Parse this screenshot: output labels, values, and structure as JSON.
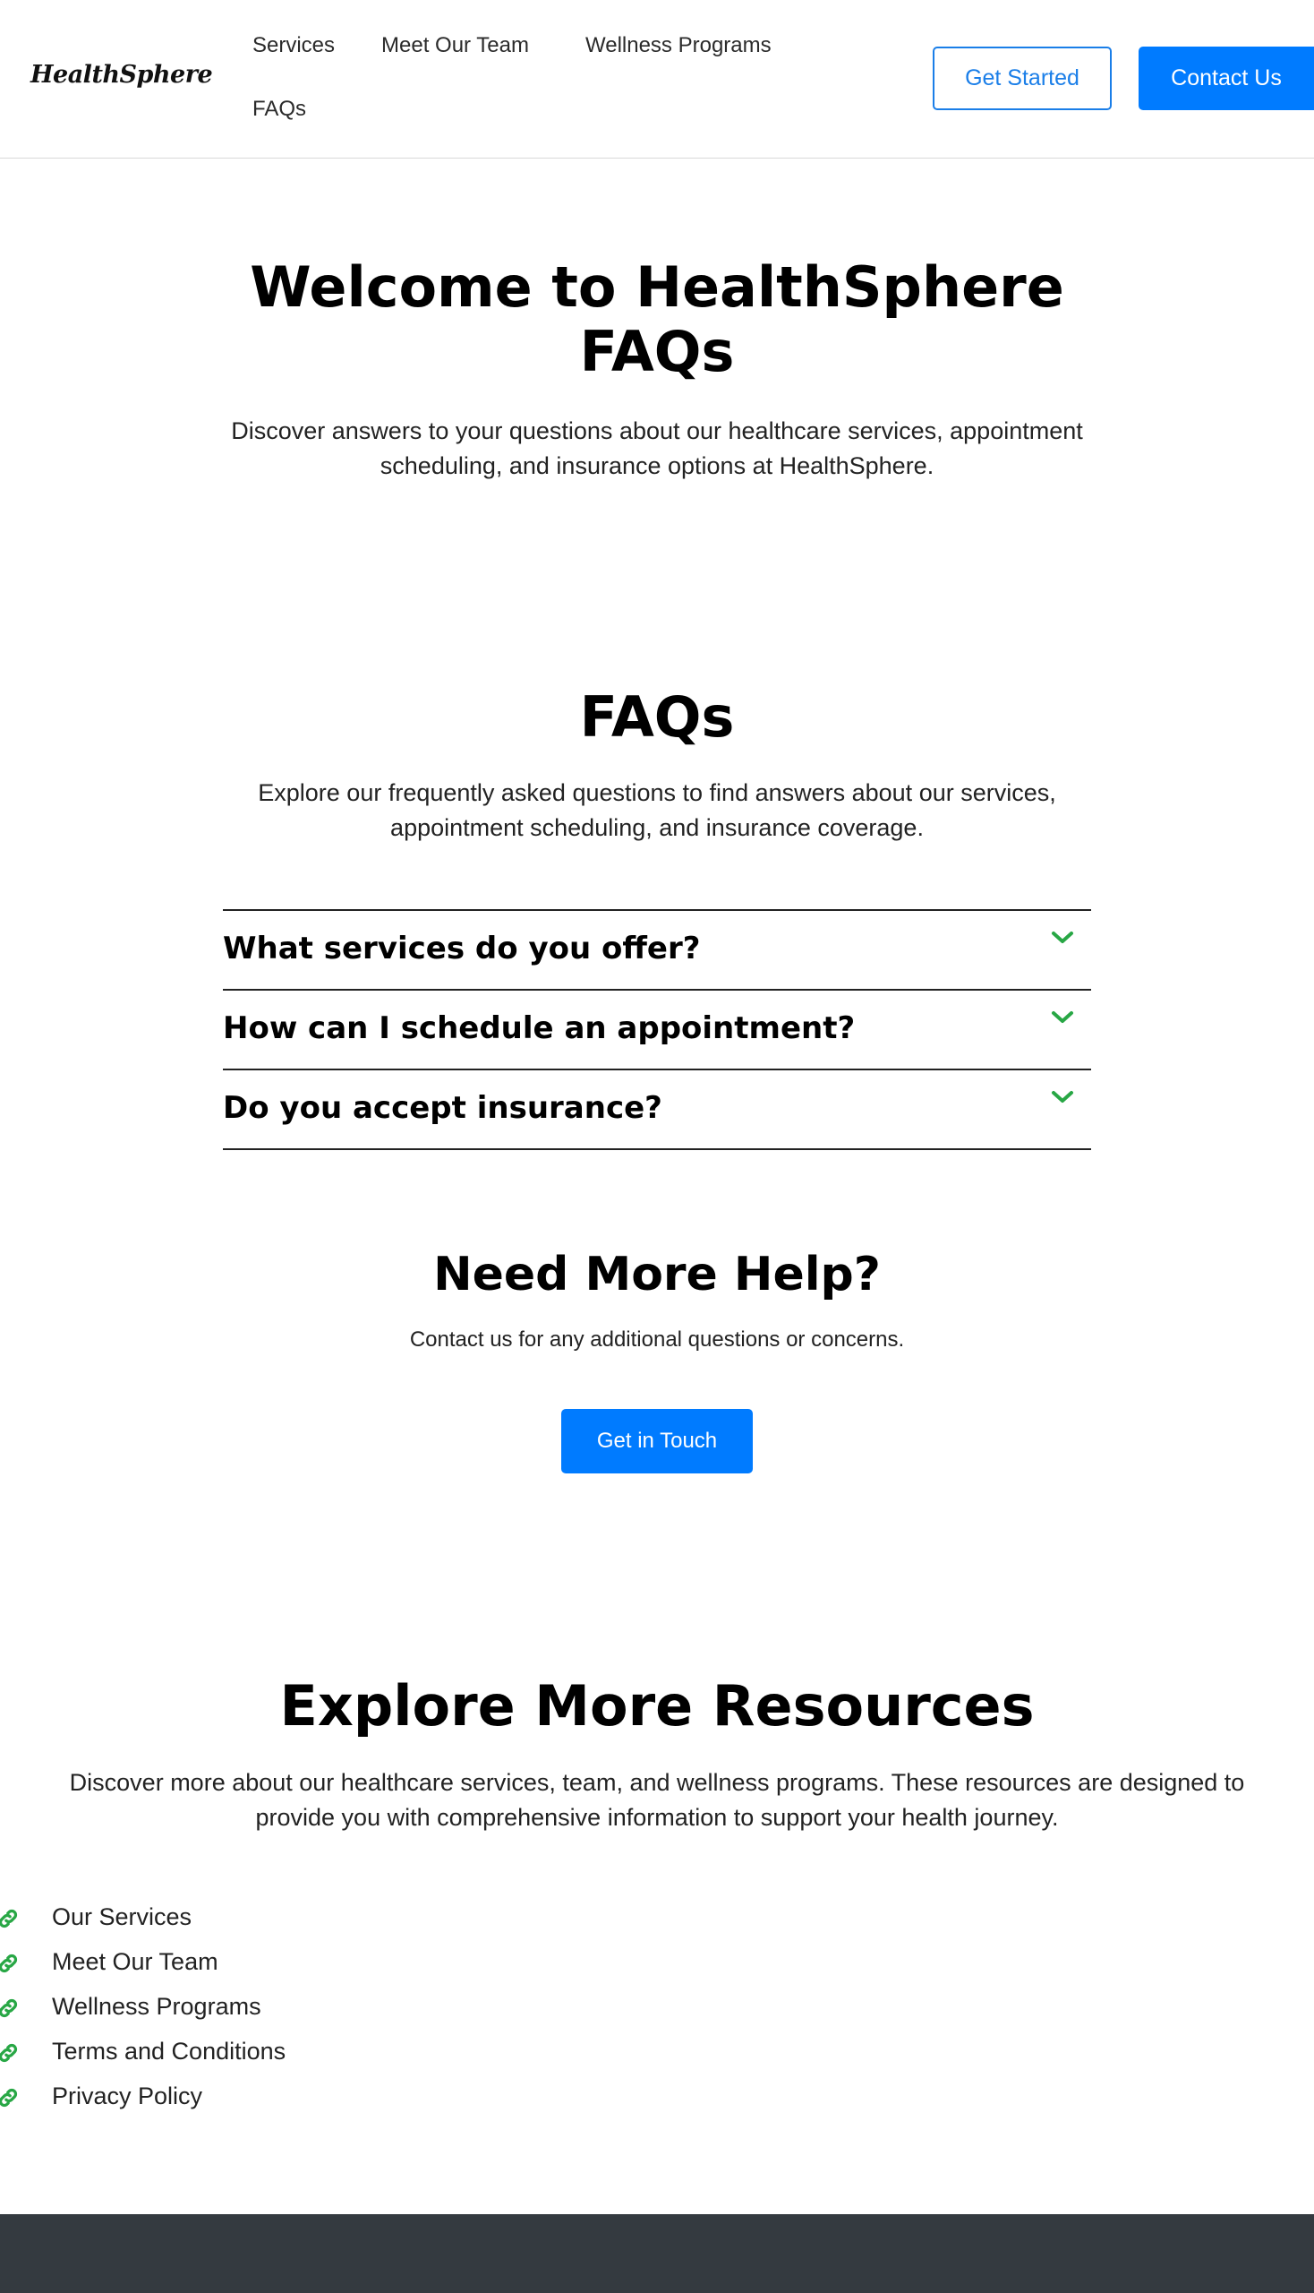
{
  "header": {
    "logo": "HealthSphere",
    "nav": [
      "Services",
      "Meet Our Team",
      "Wellness Programs",
      "FAQs"
    ],
    "get_started": "Get Started",
    "contact_us": "Contact Us"
  },
  "hero": {
    "title": "Welcome to HealthSphere FAQs",
    "subtitle": "Discover answers to your questions about our healthcare services, appointment scheduling, and insurance options at HealthSphere."
  },
  "faq": {
    "title": "FAQs",
    "subtitle": "Explore our frequently asked questions to find answers about our services, appointment scheduling, and insurance coverage.",
    "items": [
      "What services do you offer?",
      "How can I schedule an appointment?",
      "Do you accept insurance?"
    ],
    "chevron_icon": "chevron-down-icon",
    "accent_color": "#28a745"
  },
  "help": {
    "title": "Need More Help?",
    "subtitle": "Contact us for any additional questions or concerns.",
    "button": "Get in Touch"
  },
  "resources": {
    "title": "Explore More Resources",
    "subtitle": "Discover more about our healthcare services, team, and wellness programs. These resources are designed to provide you with comprehensive information to support your health journey.",
    "links": [
      "Our Services",
      "Meet Our Team",
      "Wellness Programs",
      "Terms and Conditions",
      "Privacy Policy"
    ],
    "link_icon": "link-icon"
  },
  "colors": {
    "primary": "#007bff",
    "accent": "#28a745",
    "footer": "#343a40"
  }
}
